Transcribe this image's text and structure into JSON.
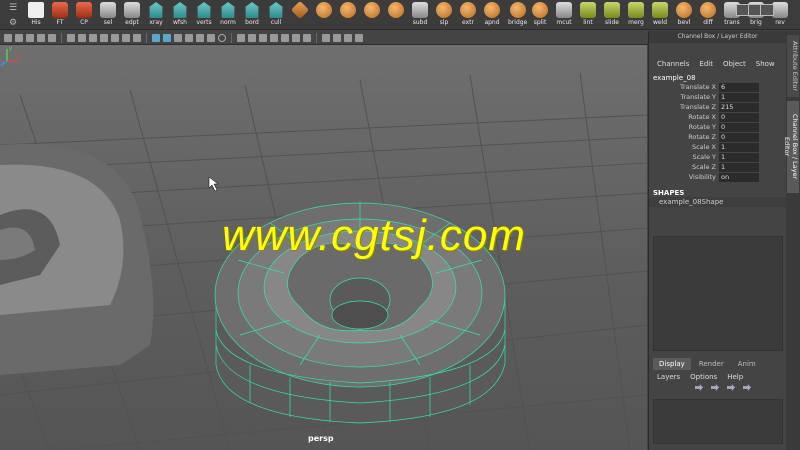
{
  "shelf": {
    "items": [
      {
        "label": "His",
        "icon": "white"
      },
      {
        "label": "FT",
        "icon": "red"
      },
      {
        "label": "CP",
        "icon": "red"
      },
      {
        "label": "sel",
        "icon": "grey"
      },
      {
        "label": "edpt",
        "icon": "grey"
      },
      {
        "label": "xray",
        "icon": "teal"
      },
      {
        "label": "wfsh",
        "icon": "teal"
      },
      {
        "label": "verts",
        "icon": "teal"
      },
      {
        "label": "norm",
        "icon": "teal"
      },
      {
        "label": "bord",
        "icon": "teal"
      },
      {
        "label": "cull",
        "icon": "teal"
      },
      {
        "label": "",
        "icon": "cube"
      },
      {
        "label": "",
        "icon": "orange"
      },
      {
        "label": "",
        "icon": "orange"
      },
      {
        "label": "",
        "icon": "orange"
      },
      {
        "label": "",
        "icon": "orange"
      },
      {
        "label": "subd",
        "icon": "grey"
      },
      {
        "label": "slp",
        "icon": "orange"
      },
      {
        "label": "extr",
        "icon": "orange"
      },
      {
        "label": "apnd",
        "icon": "orange"
      },
      {
        "label": "bridge",
        "icon": "orange"
      },
      {
        "label": "split",
        "icon": "orange"
      },
      {
        "label": "mcut",
        "icon": "grey"
      },
      {
        "label": "lint",
        "icon": "green"
      },
      {
        "label": "slide",
        "icon": "green"
      },
      {
        "label": "merg",
        "icon": "green"
      },
      {
        "label": "weld",
        "icon": "green"
      },
      {
        "label": "bevl",
        "icon": "orange"
      },
      {
        "label": "diff",
        "icon": "orange"
      },
      {
        "label": "trans",
        "icon": "grey"
      },
      {
        "label": "brig",
        "icon": "grey"
      },
      {
        "label": "rev",
        "icon": "grey"
      }
    ]
  },
  "viewport": {
    "camera_label": "persp",
    "watermark": "www.cgtsj.com",
    "axis_x": "X",
    "axis_y": "Y",
    "axis_z": "Z"
  },
  "channel_box": {
    "title": "Channel Box / Layer Editor",
    "menu": [
      "Channels",
      "Edit",
      "Object",
      "Show"
    ],
    "object_name": "example_08",
    "attributes": [
      {
        "label": "Translate X",
        "value": "6"
      },
      {
        "label": "Translate Y",
        "value": "1"
      },
      {
        "label": "Translate Z",
        "value": "215"
      },
      {
        "label": "Rotate X",
        "value": "0"
      },
      {
        "label": "Rotate Y",
        "value": "0"
      },
      {
        "label": "Rotate Z",
        "value": "0"
      },
      {
        "label": "Scale X",
        "value": "1"
      },
      {
        "label": "Scale Y",
        "value": "1"
      },
      {
        "label": "Scale Z",
        "value": "1"
      },
      {
        "label": "Visibility",
        "value": "on"
      }
    ],
    "shapes_heading": "SHAPES",
    "shape_name": "example_08Shape"
  },
  "layer_editor": {
    "tabs": [
      "Display",
      "Render",
      "Anim"
    ],
    "active_tab": "Display",
    "menu": [
      "Layers",
      "Options",
      "Help"
    ]
  },
  "side_tabs": {
    "attribute_editor": "Attribute Editor",
    "channel_box": "Channel Box / Layer Editor"
  },
  "colors": {
    "wireframe": "#33e6a0",
    "watermark": "#ffff00",
    "viewport_bg": "#666666"
  }
}
